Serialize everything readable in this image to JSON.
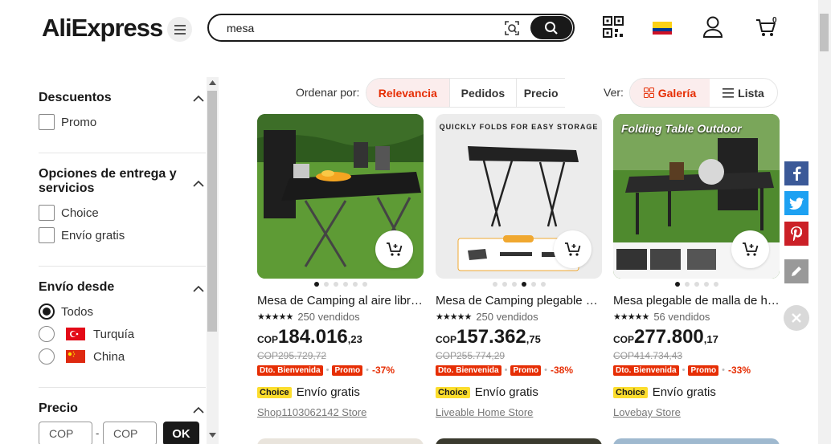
{
  "header": {
    "logo": "AliExpress",
    "search": {
      "value": "mesa",
      "placeholder": ""
    },
    "cart_count": "0",
    "country_flag": "Colombia"
  },
  "sidebar": {
    "discounts": {
      "title": "Descuentos",
      "options": [
        "Promo"
      ]
    },
    "delivery": {
      "title": "Opciones de entrega y servicios",
      "options": [
        "Choice",
        "Envío gratis"
      ]
    },
    "ships_from": {
      "title": "Envío desde",
      "options": [
        "Todos",
        "Turquía",
        "China"
      ],
      "selected": "Todos"
    },
    "price": {
      "title": "Precio",
      "min_placeholder": "COP",
      "max_placeholder": "COP",
      "separator": "-",
      "ok_label": "OK"
    }
  },
  "sortbar": {
    "label": "Ordenar por:",
    "tabs": [
      "Relevancia",
      "Pedidos",
      "Precio"
    ],
    "active": "Relevancia",
    "view_label": "Ver:",
    "view_tabs": [
      "Galería",
      "Lista"
    ],
    "view_active": "Galería"
  },
  "products": [
    {
      "title": "Mesa de Camping al aire libre plegable",
      "image_caption": "",
      "rating": 4.5,
      "sold": "250 vendidos",
      "currency": "COP",
      "price_int": "184.016",
      "price_dec": ",23",
      "old_price": "COP295.729,72",
      "badge1": "Dto. Bienvenida",
      "badge2": "Promo",
      "discount": "-37%",
      "choice": "Choice",
      "shipping": "Envío gratis",
      "store": "Shop1103062142 Store",
      "dots": 6,
      "active_dot": 0
    },
    {
      "title": "Mesa de Camping plegable portátil",
      "image_caption": "QUICKLY FOLDS FOR EASY STORAGE",
      "rating": 5,
      "sold": "250 vendidos",
      "currency": "COP",
      "price_int": "157.362",
      "price_dec": ",75",
      "old_price": "COP255.774,29",
      "badge1": "Dto. Bienvenida",
      "badge2": "Promo",
      "discount": "-38%",
      "choice": "Choice",
      "shipping": "Envío gratis",
      "store": "Liveable Home Store",
      "dots": 6,
      "active_dot": 3
    },
    {
      "title": "Mesa plegable de malla de hierro",
      "image_caption": "Folding Table Outdoor",
      "rating": 5,
      "sold": "56 vendidos",
      "currency": "COP",
      "price_int": "277.800",
      "price_dec": ",17",
      "old_price": "COP414.734,43",
      "badge1": "Dto. Bienvenida",
      "badge2": "Promo",
      "discount": "-33%",
      "choice": "Choice",
      "shipping": "Envío gratis",
      "store": "Lovebay Store",
      "dots": 5,
      "active_dot": 0
    }
  ],
  "share_bar": [
    "facebook-icon",
    "twitter-icon",
    "pinterest-icon",
    "edit-icon",
    "close-icon"
  ]
}
